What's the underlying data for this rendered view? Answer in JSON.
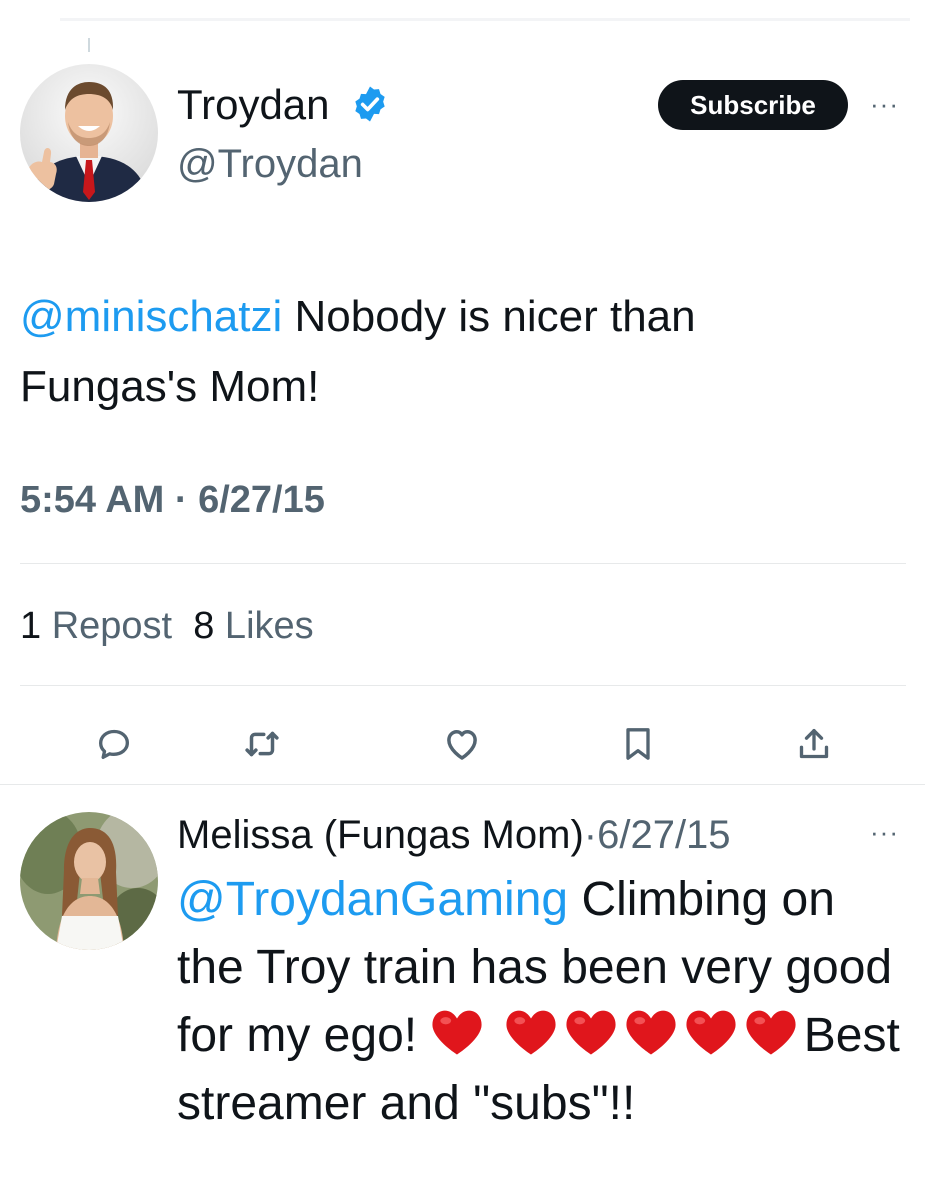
{
  "tweet": {
    "author_name": "Troydan",
    "author_handle": "@Troydan",
    "subscribe_label": "Subscribe",
    "more_glyph": "···",
    "mention": "@minischatzi",
    "body": " Nobody is nicer than Fungas's Mom!",
    "timestamp": "5:54 AM · 6/27/15",
    "reposts_count": "1",
    "reposts_label": " Repost",
    "likes_count": "8",
    "likes_label": " Likes",
    "actions": [
      "reply-icon",
      "repost-icon",
      "like-icon",
      "bookmark-icon",
      "share-icon"
    ]
  },
  "reply": {
    "author_name": "Melissa (Fungas Mom)",
    "separator": "·",
    "date": "6/27/15",
    "more_glyph": "···",
    "mention": "@TroydanGaming",
    "body_1": " Climbing on the Troy train has been very good for my ego! ",
    "body_2": "Best streamer and \"subs\"!!",
    "emoji": "red-heart"
  },
  "colors": {
    "accent": "#1d9bf0",
    "text": "#0f1419",
    "secondary": "#536471",
    "heart": "#e0161c"
  }
}
